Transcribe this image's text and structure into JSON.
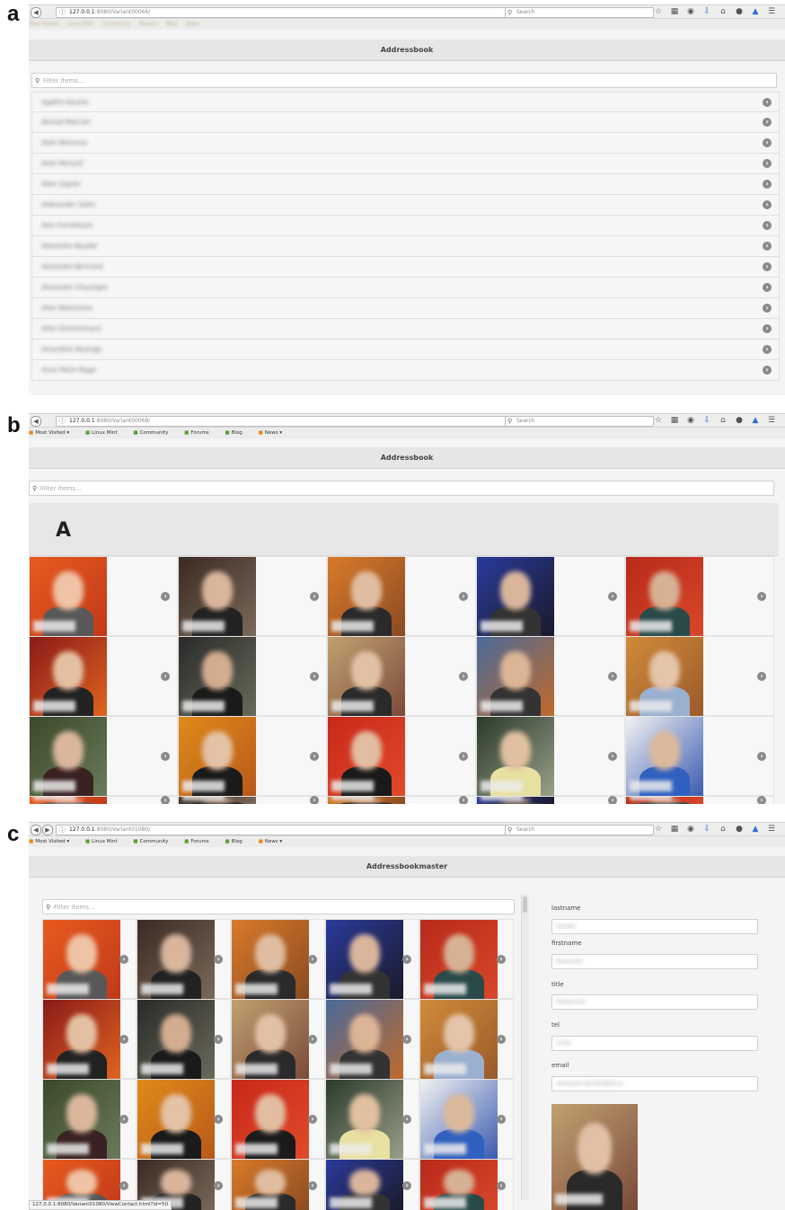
{
  "panels": {
    "a": {
      "letter": "a",
      "url_host": "127.0.0.1",
      "url_path": ":8080/Variant00066/",
      "search_placeholder": "Search",
      "bookmarks": [
        "Most Visited",
        "Linux Mint",
        "Community",
        "Forums",
        "Blog",
        "News"
      ],
      "title": "Addressbook",
      "filter_placeholder": "Filter items...",
      "items": [
        "Agathe Gautier",
        "Akmad Malcrait",
        "Alain Monceau",
        "Alain Renault",
        "Alain Vagner",
        "Aleksander Gatin",
        "Alex Cornelissen",
        "Alexandre Baudet",
        "Alexandre Bertrand",
        "Alexandre Chauviges",
        "Allan Belounova",
        "Allan Zimmermann",
        "Amandine Barange",
        "Anne Marie Mage"
      ]
    },
    "b": {
      "letter": "b",
      "url_host": "127.0.0.1",
      "url_path": ":8080/Variant00068/",
      "search_placeholder": "Search",
      "bookmarks": [
        "Most Visited ▾",
        "Linux Mint",
        "Community",
        "Forums",
        "Blog",
        "News ▾"
      ],
      "title": "Addressbook",
      "filter_placeholder": "Filter items...",
      "section_letter": "A"
    },
    "c": {
      "letter": "c",
      "url_host": "127.0.0.1",
      "url_path": ":8080/Variant01080/",
      "search_placeholder": "Search",
      "bookmarks": [
        "Most Visited ▾",
        "Linux Mint",
        "Community",
        "Forums",
        "Blog",
        "News ▾"
      ],
      "title": "Addressbookmaster",
      "filter_placeholder": "Filter items...",
      "form": {
        "lastname_label": "lastname",
        "lastname_value": "Gautier",
        "firstname_label": "firstname",
        "firstname_value": "Alexandre",
        "title_label": "title",
        "title_value": "Researcher",
        "tel_label": "tel",
        "tel_value": "2728",
        "email_label": "email",
        "email_value": "alexandre.baudet@list.lu"
      },
      "status_url": "127.0.0.1:8080/Variant01080/ViewContact.html?id=50"
    }
  },
  "icons": {
    "back": "back-arrow-icon",
    "search": "magnifier-icon",
    "star": "star-icon",
    "clipboard": "clipboard-icon",
    "pocket": "pocket-icon",
    "download": "download-icon",
    "home": "home-icon",
    "chat": "chat-icon",
    "sync": "sync-icon",
    "menu": "hamburger-menu-icon",
    "chevron": "chevron-right-circle-icon"
  },
  "colors": {
    "accent_blue": "#2b6fd6",
    "chevron_gray": "#8a8a8a",
    "title_bar": "#e6e6e6"
  }
}
